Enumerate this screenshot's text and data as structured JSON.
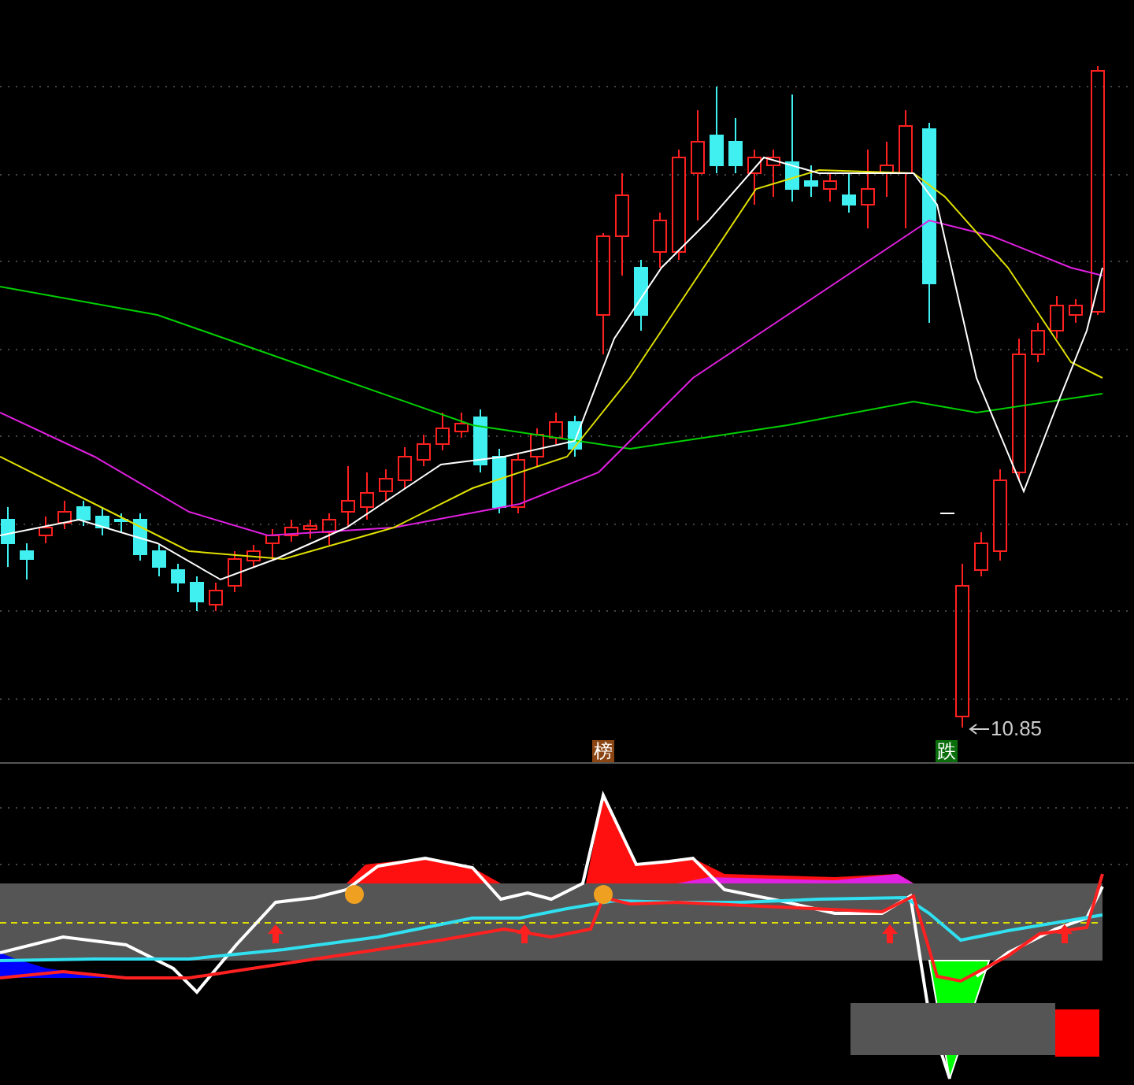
{
  "price_chart": {
    "low_marker": {
      "label": "10.85"
    }
  },
  "signals": [
    {
      "label": "榜",
      "color": "#8b4513"
    },
    {
      "label": "跌",
      "color": "#0a6e0a"
    }
  ]
}
